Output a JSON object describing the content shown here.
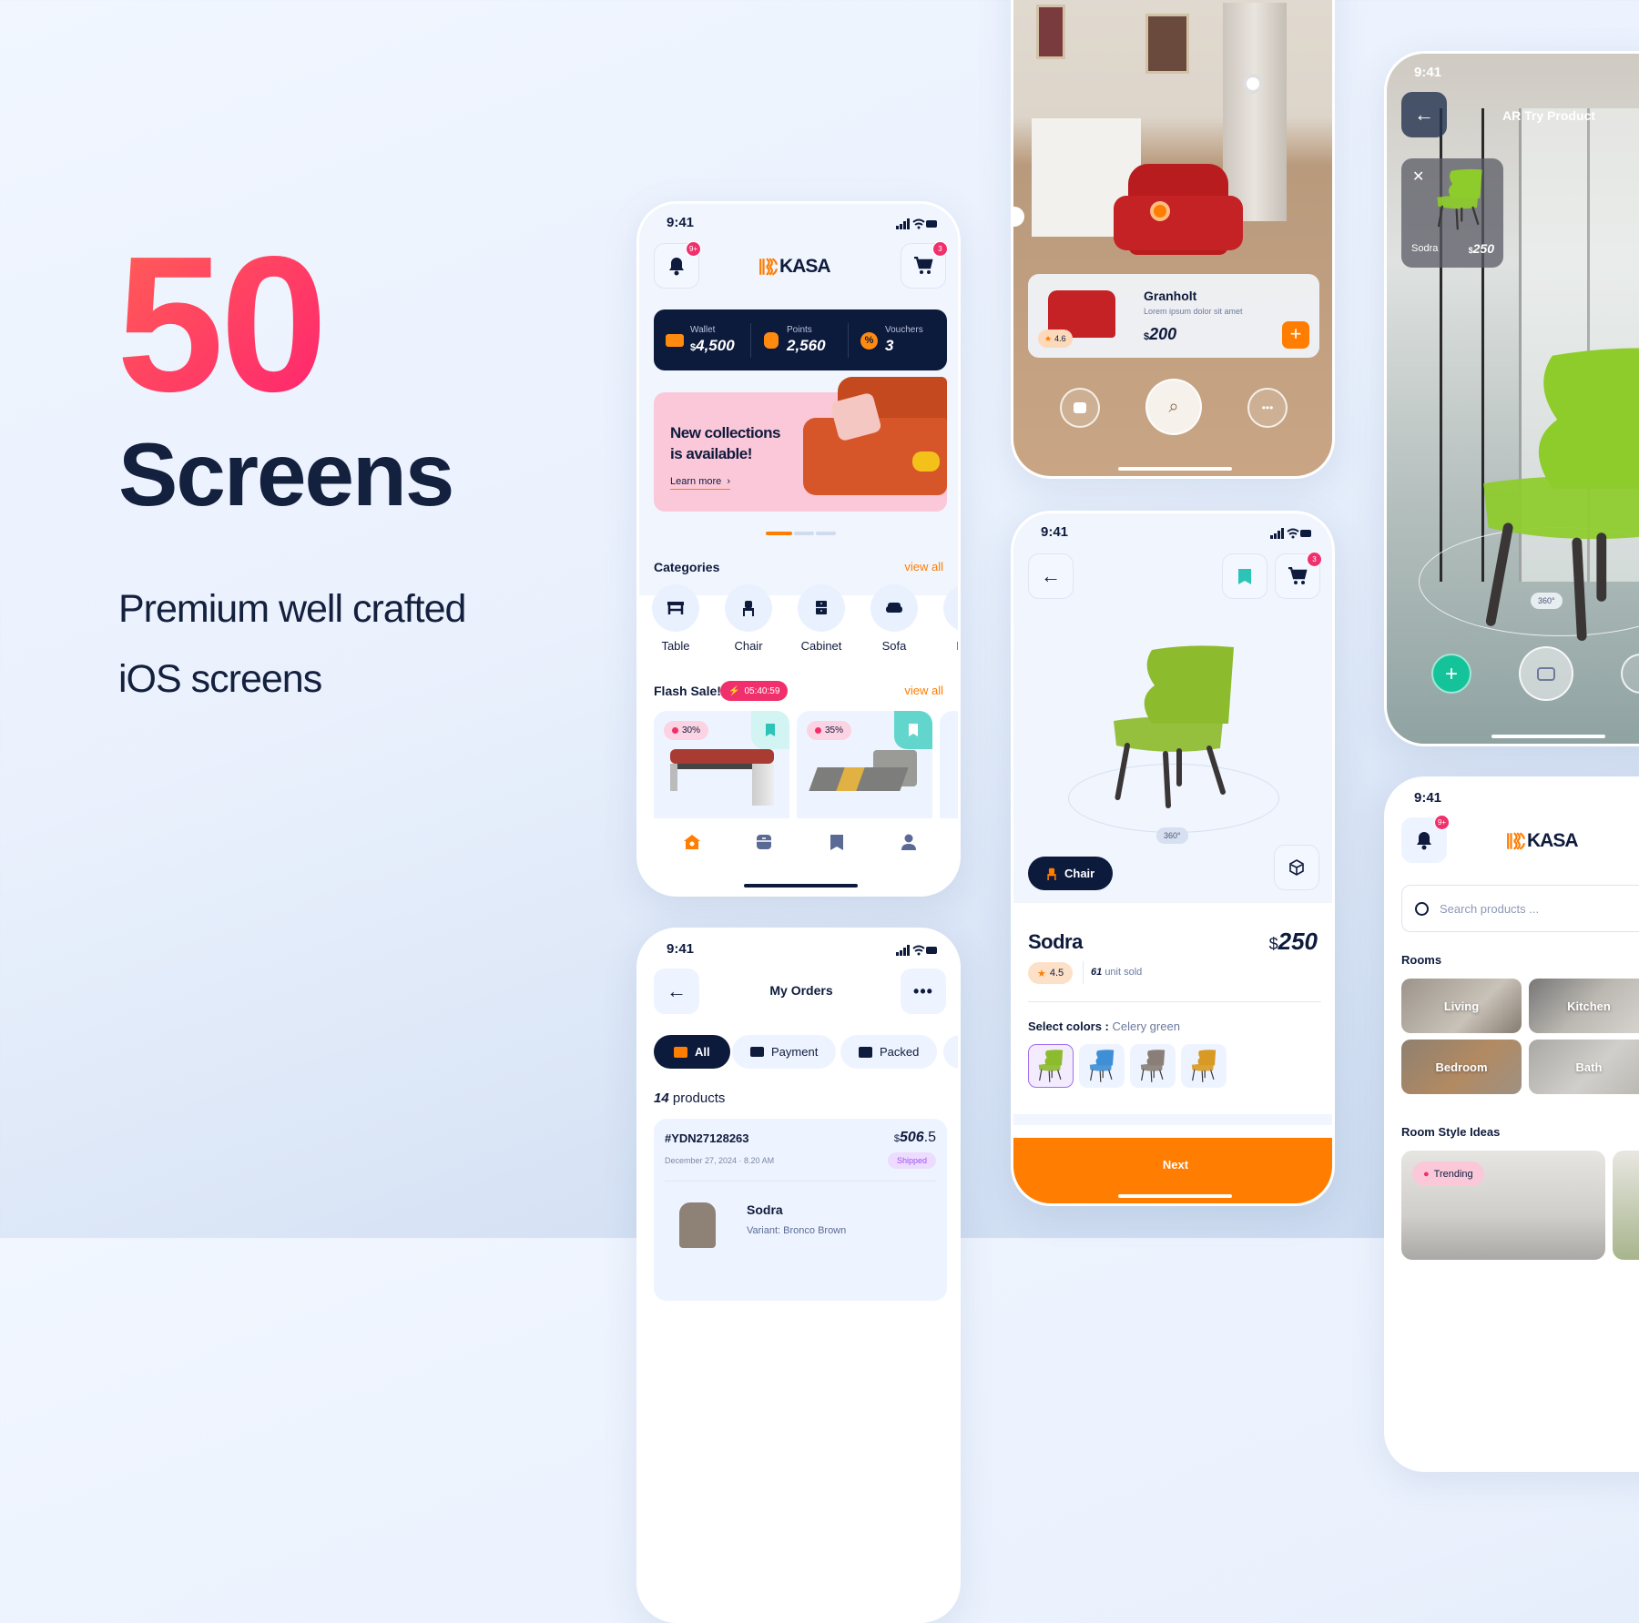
{
  "colors": {
    "navy": "#0c1a3c",
    "orange": "#ff7d00",
    "pink": "#f0306c",
    "teal": "#3fd1c6",
    "background": "#eef4fe"
  },
  "hero": {
    "number": "50",
    "title": "Screens",
    "subtitle_line1": "Premium well crafted",
    "subtitle_line2": "iOS screens"
  },
  "home": {
    "time": "9:41",
    "logo_text": "KASA",
    "notification_badge": "9+",
    "cart_badge": "3",
    "wallet": {
      "label": "Wallet",
      "currency": "$",
      "value": "4,500",
      "icon": "wallet-icon"
    },
    "points": {
      "label": "Points",
      "value": "2,560",
      "icon": "medal-icon"
    },
    "vouchers": {
      "label": "Vouchers",
      "value": "3",
      "icon": "discount-icon"
    },
    "banner": {
      "title_line1": "New collections",
      "title_line2": "is available!",
      "link": "Learn more",
      "carousel_active": 1,
      "carousel_total": 3
    },
    "categories": {
      "title": "Categories",
      "view_all": "view all",
      "items": [
        {
          "label": "Table",
          "icon": "table-icon"
        },
        {
          "label": "Chair",
          "icon": "chair-icon"
        },
        {
          "label": "Cabinet",
          "icon": "cabinet-icon"
        },
        {
          "label": "Sofa",
          "icon": "sofa-icon"
        },
        {
          "label": "Bed",
          "icon": "bed-icon"
        }
      ]
    },
    "flash_sale": {
      "title": "Flash Sale!",
      "timer": "05:40:59",
      "view_all": "view all",
      "items": [
        {
          "discount": "30%",
          "bookmarked": false
        },
        {
          "discount": "35%",
          "bookmarked": true
        }
      ]
    },
    "nav": [
      {
        "icon": "home-icon",
        "active": true
      },
      {
        "icon": "archive-icon"
      },
      {
        "icon": "bookmark-icon"
      },
      {
        "icon": "user-icon"
      }
    ]
  },
  "orders": {
    "time": "9:41",
    "title": "My Orders",
    "tabs": [
      {
        "label": "All",
        "active": true
      },
      {
        "label": "Payment"
      },
      {
        "label": "Packed"
      }
    ],
    "count": "14",
    "count_label": "products",
    "order": {
      "id": "#YDN27128263",
      "currency": "$",
      "price_main": "506",
      "price_decimal": ".5",
      "date": "December 27, 2024 · 8.20 AM",
      "status": "Shipped",
      "item": {
        "name": "Sodra",
        "variant_label": "Variant:",
        "variant": "Bronco Brown"
      }
    }
  },
  "ar_granholt": {
    "product": {
      "name": "Granholt",
      "description": "Lorem ipsum dolor sit amet",
      "currency": "$",
      "price": "200",
      "rating": "4.6"
    }
  },
  "detail": {
    "time": "9:41",
    "cart_badge": "3",
    "rotation_label": "360°",
    "category": "Chair",
    "name": "Sodra",
    "currency": "$",
    "price": "250",
    "rating": "4.5",
    "sold_count": "61",
    "sold_label": "unit sold",
    "colors_label": "Select colors :",
    "selected_color": "Celery green",
    "swatches": [
      {
        "name": "Celery green",
        "hex": "#8dbb2e",
        "selected": true
      },
      {
        "name": "Blue",
        "hex": "#3f8fd6"
      },
      {
        "name": "Grey",
        "hex": "#8a7f78"
      },
      {
        "name": "Mustard",
        "hex": "#d99a25"
      }
    ],
    "next_label": "Next"
  },
  "ar_try": {
    "time": "9:41",
    "title": "AR Try Product",
    "product": {
      "name": "Sodra",
      "currency": "$",
      "price": "250"
    },
    "rotation_label": "360°"
  },
  "rooms": {
    "time": "9:41",
    "logo_text": "KASA",
    "notification_badge": "9+",
    "search_placeholder": "Search products ...",
    "rooms_title": "Rooms",
    "rooms": [
      {
        "label": "Living"
      },
      {
        "label": "Kitchen"
      },
      {
        "label": "Bedroom"
      },
      {
        "label": "Bath"
      }
    ],
    "ideas_title": "Room Style Ideas",
    "trending_label": "Trending"
  }
}
